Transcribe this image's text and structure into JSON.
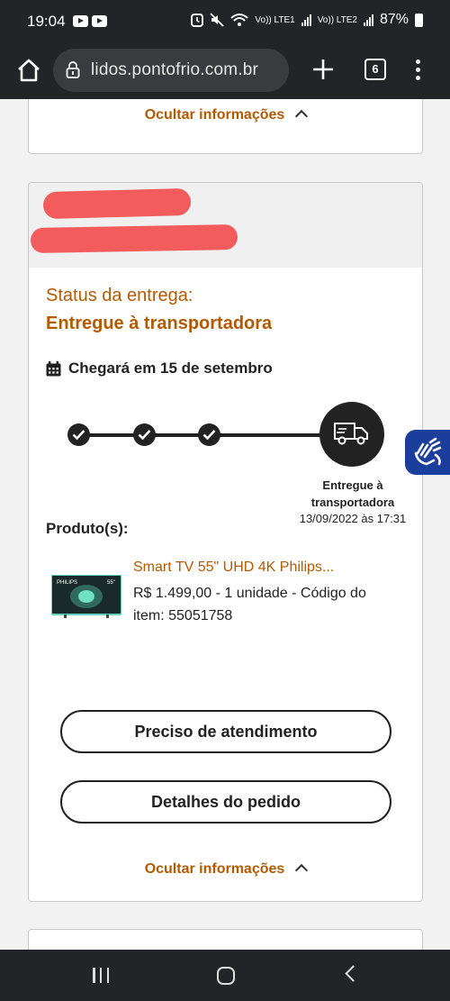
{
  "status_bar": {
    "time": "19:04",
    "sim1": "Vo)) LTE1",
    "sim2": "Vo)) LTE2",
    "battery": "87%"
  },
  "browser": {
    "url": "lidos.pontofrio.com.br",
    "tab_count": "6"
  },
  "order": {
    "hide_info_label": "Ocultar informações",
    "status_label": "Status da entrega:",
    "status_value": "Entregue à transportadora",
    "arrival": "Chegará em 15 de setembro",
    "progress_completed_steps": 3,
    "current_step": {
      "title_line1": "Entregue à",
      "title_line2": "transportadora",
      "date": "13/09/2022 às 17:31"
    },
    "products_title": "Produto(s):",
    "product": {
      "name": "Smart TV 55\" UHD 4K Philips...",
      "details": "R$ 1.499,00 - 1 unidade - Código do item: 55051758",
      "thumb_brand": "PHILIPS",
      "thumb_size": "55\""
    },
    "support_button": "Preciso de atendimento",
    "details_button": "Detalhes do pedido"
  },
  "colors": {
    "accent": "#b35a00",
    "redaction": "#f25c5c",
    "a11y_blue": "#1b3d9c",
    "system_bar": "#232428"
  }
}
